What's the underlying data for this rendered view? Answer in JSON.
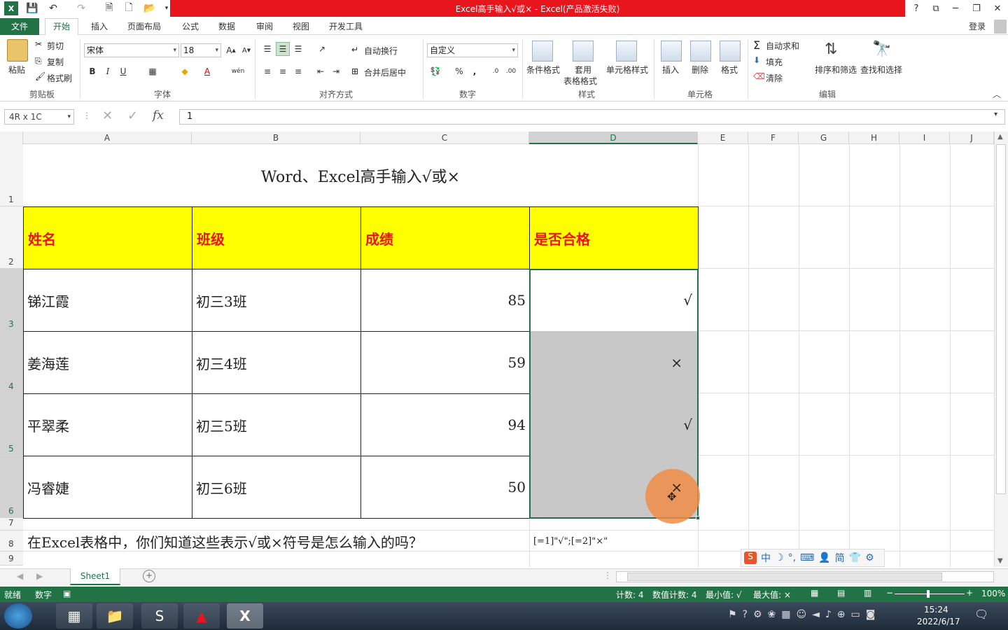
{
  "window": {
    "title": "Excel高手输入√或× - Excel(产品激活失败)",
    "help": "?",
    "controls": [
      "⧉",
      "─",
      "❐",
      "✕"
    ]
  },
  "tabs": {
    "file": "文件",
    "home": "开始",
    "items": [
      "插入",
      "页面布局",
      "公式",
      "数据",
      "审阅",
      "视图",
      "开发工具"
    ],
    "login": "登录"
  },
  "ribbon": {
    "clipboard": {
      "paste": "粘贴",
      "cut": "剪切",
      "copy": "复制",
      "format_painter": "格式刷",
      "group": "剪贴板"
    },
    "font": {
      "name": "宋体",
      "size": "18",
      "group": "字体",
      "bold": "B",
      "italic": "I",
      "underline": "U"
    },
    "alignment": {
      "wrap": "自动换行",
      "merge": "合并后居中",
      "group": "对齐方式"
    },
    "number": {
      "format": "自定义",
      "percent": "%",
      "comma": ",",
      "group": "数字"
    },
    "styles": {
      "conditional": "条件格式",
      "table1": "套用",
      "table2": "表格格式",
      "cell": "单元格样式",
      "group": "样式"
    },
    "cells": {
      "insert": "插入",
      "delete": "删除",
      "format": "格式",
      "group": "单元格"
    },
    "editing": {
      "autosum": "自动求和",
      "fill": "填充",
      "clear": "清除",
      "sort": "排序和筛选",
      "find": "查找和选择",
      "group": "编辑"
    }
  },
  "formula": {
    "namebox": "4R x 1C",
    "value": "1"
  },
  "columns": [
    "A",
    "B",
    "C",
    "D",
    "E",
    "F",
    "G",
    "H",
    "I",
    "J"
  ],
  "rows": [
    "1",
    "2",
    "3",
    "4",
    "5",
    "6",
    "7",
    "8",
    "9"
  ],
  "sheet": {
    "title": "Word、Excel高手输入√或×",
    "headers": [
      "姓名",
      "班级",
      "成绩",
      "是否合格"
    ],
    "data": [
      [
        "锑江霞",
        "初三3班",
        "85",
        "√"
      ],
      [
        "姜海莲",
        "初三4班",
        "59",
        "×"
      ],
      [
        "平翠柔",
        "初三5班",
        "94",
        "√"
      ],
      [
        "冯睿婕",
        "初三6班",
        "50",
        "×"
      ]
    ],
    "question": "在Excel表格中，你们知道这些表示√或×符号是怎么输入的吗？",
    "format_hint": "[=1]\"√\";[=2]\"×\""
  },
  "ime": [
    "中",
    "简"
  ],
  "sheet_tab": "Sheet1",
  "status": {
    "ready": "就绪",
    "mode": "数字",
    "count": "计数: 4",
    "numcount": "数值计数: 4",
    "min": "最小值: √",
    "max": "最大值: ×",
    "zoom": "100%"
  },
  "taskbar": {
    "time": "15:24",
    "date": "2022/6/17"
  },
  "colors": {
    "excel_green": "#217346",
    "title_red": "#e8161c",
    "header_yellow": "#ffff00",
    "selection_gray": "#c8c8c8"
  }
}
